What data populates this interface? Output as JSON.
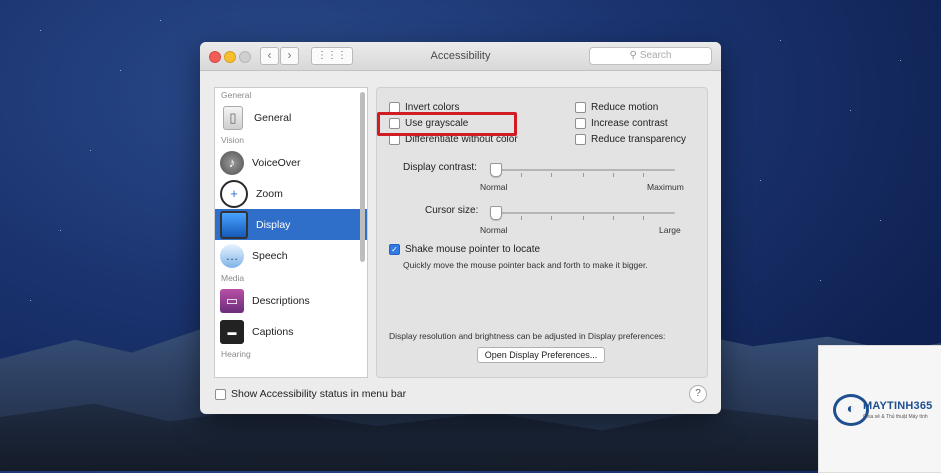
{
  "window": {
    "title": "Accessibility",
    "search_placeholder": "Search",
    "nav_back": "‹",
    "nav_forward": "›",
    "grid": "⋮⋮⋮"
  },
  "sidebar": {
    "sections": [
      {
        "label": "General"
      },
      {
        "label": "Vision"
      },
      {
        "label": "Media"
      },
      {
        "label": "Hearing"
      }
    ],
    "items": [
      {
        "label": "General",
        "icon": "general-icon"
      },
      {
        "label": "VoiceOver",
        "icon": "voiceover-icon"
      },
      {
        "label": "Zoom",
        "icon": "zoom-icon"
      },
      {
        "label": "Display",
        "icon": "display-icon",
        "selected": true
      },
      {
        "label": "Speech",
        "icon": "speech-icon"
      },
      {
        "label": "Descriptions",
        "icon": "descriptions-icon"
      },
      {
        "label": "Captions",
        "icon": "captions-icon"
      }
    ]
  },
  "display": {
    "checkboxes_left": [
      {
        "label": "Invert colors",
        "checked": false
      },
      {
        "label": "Use grayscale",
        "checked": false
      },
      {
        "label": "Differentiate without color",
        "checked": false
      }
    ],
    "checkboxes_right": [
      {
        "label": "Reduce motion",
        "checked": false
      },
      {
        "label": "Increase contrast",
        "checked": false
      },
      {
        "label": "Reduce transparency",
        "checked": false
      }
    ],
    "contrast_label": "Display contrast:",
    "contrast_min": "Normal",
    "contrast_max": "Maximum",
    "contrast_value": 0,
    "cursor_label": "Cursor size:",
    "cursor_min": "Normal",
    "cursor_max": "Large",
    "cursor_value": 0,
    "shake_label": "Shake mouse pointer to locate",
    "shake_checked": true,
    "shake_help": "Quickly move the mouse pointer back and forth to make it bigger.",
    "resolution_note": "Display resolution and brightness can be adjusted in Display preferences:",
    "open_prefs_button": "Open Display Preferences..."
  },
  "footer": {
    "status_menu_label": "Show Accessibility status in menu bar",
    "help": "?"
  },
  "watermark": {
    "name": "MAYTINH365",
    "tagline": "Chia sẻ & Thủ thuật Máy tính"
  },
  "colors": {
    "selection_blue": "#2f6ec9",
    "highlight_red": "#d11c24"
  }
}
